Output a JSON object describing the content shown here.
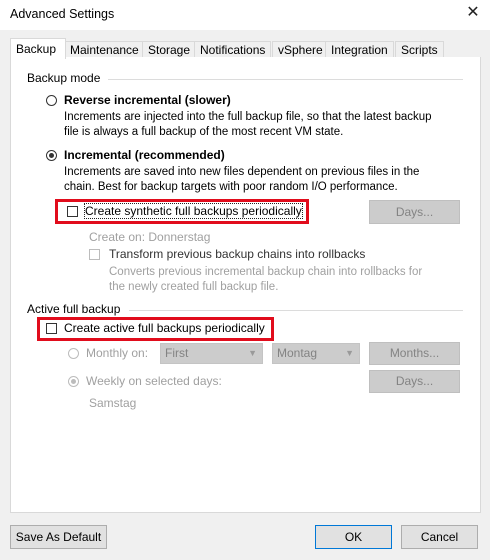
{
  "window": {
    "title": "Advanced Settings",
    "close_glyph": "✕"
  },
  "tabs": [
    {
      "label": "Backup",
      "active": true
    },
    {
      "label": "Maintenance"
    },
    {
      "label": "Storage"
    },
    {
      "label": "Notifications"
    },
    {
      "label": "vSphere"
    },
    {
      "label": "Integration"
    },
    {
      "label": "Scripts"
    }
  ],
  "backup_mode": {
    "group_title": "Backup mode",
    "reverse": {
      "label": "Reverse incremental (slower)",
      "desc1": "Increments are injected into the full backup file, so that the latest backup",
      "desc2": "file is always a full backup of the most recent VM state.",
      "checked": false
    },
    "incremental": {
      "label": "Incremental (recommended)",
      "desc1": "Increments are saved into new files dependent on previous files in the",
      "desc2": "chain. Best for backup targets with poor random I/O performance.",
      "checked": true
    },
    "synthetic": {
      "label": "Create synthetic full backups periodically",
      "checked": false
    },
    "days_button": "Days...",
    "create_on": "Create on:  Donnerstag",
    "transform": {
      "label": "Transform previous backup chains into rollbacks",
      "desc1": "Converts previous incremental backup chain into rollbacks for",
      "desc2": "the newly created full backup file."
    }
  },
  "active_full": {
    "group_title": "Active full backup",
    "create_active": {
      "label": "Create active full backups periodically",
      "checked": false
    },
    "monthly": {
      "label": "Monthly on:",
      "select1": "First",
      "select2": "Montag",
      "button": "Months..."
    },
    "weekly": {
      "label": "Weekly on selected days:",
      "button": "Days...",
      "days": "Samstag"
    }
  },
  "footer": {
    "save_default": "Save As Default",
    "ok": "OK",
    "cancel": "Cancel"
  },
  "colors": {
    "highlight": "#e10c1c",
    "focus": "#0078d7"
  }
}
